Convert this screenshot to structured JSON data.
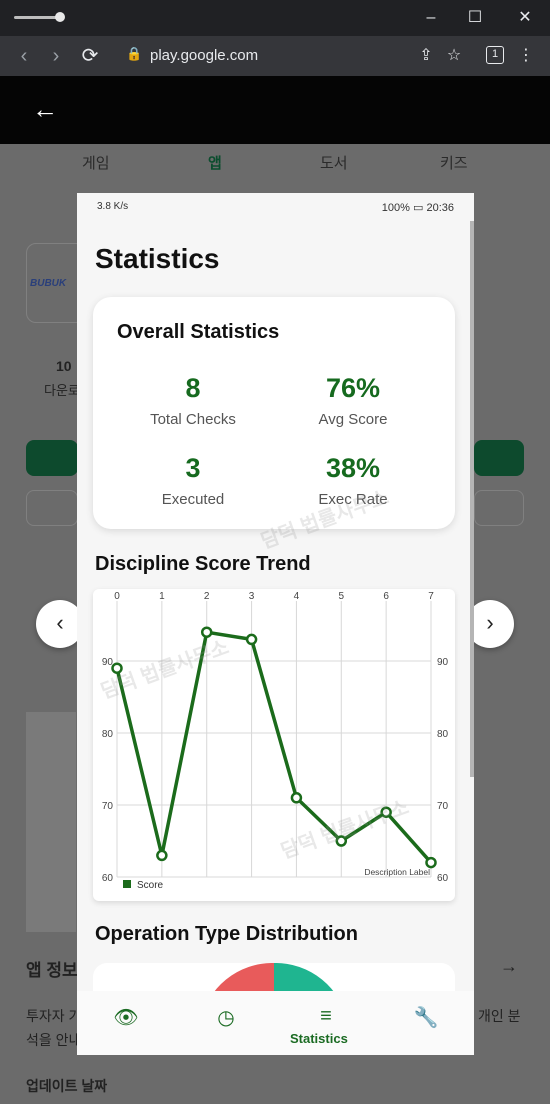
{
  "browser": {
    "url": "play.google.com",
    "tab_count": "1"
  },
  "play": {
    "tabs": [
      "게임",
      "앱",
      "도서",
      "키즈"
    ],
    "active_tab": 1,
    "downloads_partial": "10",
    "downloads_label_partial": "다운로",
    "brand_partial": "BUBUK",
    "section_app_info": "앱 정보",
    "desc_left_1": "투자자 가",
    "desc_right_1": "개인 분",
    "desc_left_2": "석을 안내",
    "update_label": "업데이트 날짜"
  },
  "phone": {
    "status": {
      "left": "3.8 K/s",
      "battery": "100%",
      "time": "20:36"
    },
    "title": "Statistics",
    "overall": {
      "title": "Overall Statistics",
      "stats": [
        {
          "value": "8",
          "label": "Total Checks"
        },
        {
          "value": "76%",
          "label": "Avg Score"
        },
        {
          "value": "3",
          "label": "Executed"
        },
        {
          "value": "38%",
          "label": "Exec Rate"
        }
      ]
    },
    "trend_title": "Discipline Score Trend",
    "distribution_title": "Operation Type Distribution",
    "nav": {
      "active_label": "Statistics"
    },
    "watermark_text": "담덕 법률사무소"
  },
  "chart_data": {
    "type": "line",
    "x": [
      0,
      1,
      2,
      3,
      4,
      5,
      6,
      7
    ],
    "series": [
      {
        "name": "Score",
        "values": [
          89,
          63,
          94,
          93,
          71,
          65,
          69,
          62
        ]
      }
    ],
    "xlim": [
      0,
      7
    ],
    "ylim": [
      60,
      95
    ],
    "yticks": [
      60,
      70,
      80,
      90
    ],
    "xticks": [
      0,
      1,
      2,
      3,
      4,
      5,
      6,
      7
    ],
    "description": "Description Label",
    "legend": "bottom-left",
    "grid": true,
    "line_color": "#1b6b1b",
    "colors": {
      "donut_red": "#e85b5b",
      "donut_teal": "#1fb590"
    }
  }
}
